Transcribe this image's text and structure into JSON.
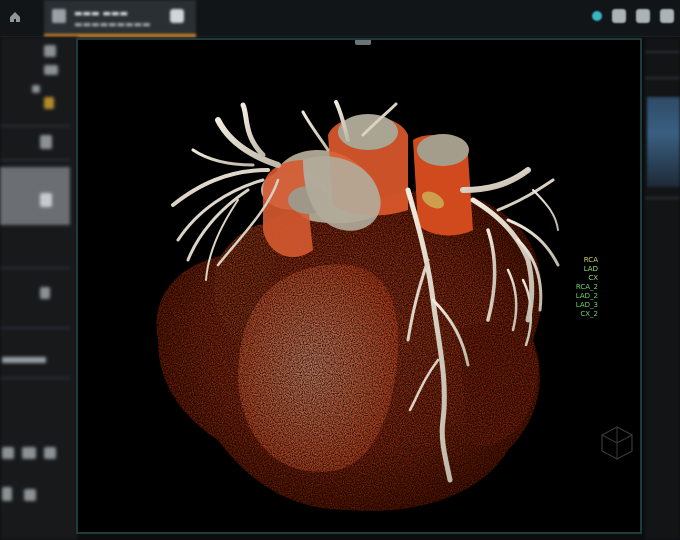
{
  "toolbar": {
    "home_icon": "home-icon",
    "tab_icons": [
      "layout-icon",
      "close-icon"
    ],
    "right_icons": [
      "status-dot-icon",
      "pen-icon",
      "camera-icon",
      "export-icon"
    ],
    "accent_color": "#d8892a"
  },
  "viewport": {
    "object": "volume-rendered-heart",
    "colors": {
      "myocardium": "#d23a12",
      "vessels": "#e8e1d3",
      "background": "#000000",
      "frame": "#1f3a3a"
    }
  },
  "vessel_legend": {
    "items": [
      {
        "label": "RCA",
        "color": "#d8d26a"
      },
      {
        "label": "LAD",
        "color": "#9fdc6a"
      },
      {
        "label": "CX",
        "color": "#9fdc6a"
      },
      {
        "label": "RCA_2",
        "color": "#6fd36b"
      },
      {
        "label": "LAD_2",
        "color": "#6fd36b"
      },
      {
        "label": "LAD_3",
        "color": "#6fd36b"
      },
      {
        "label": "CX_2",
        "color": "#6fd36b"
      }
    ]
  },
  "orientation_cube_icon": "orientation-cube-icon"
}
